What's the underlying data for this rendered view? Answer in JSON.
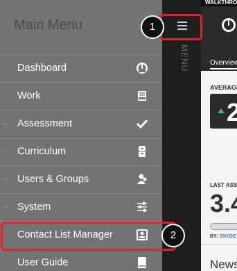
{
  "menu": {
    "title": "Main Menu",
    "items": [
      {
        "label": "Dashboard",
        "icon": "speedometer-icon",
        "has_arrow": false
      },
      {
        "label": "Work",
        "icon": "inbox-tray-icon",
        "has_arrow": true
      },
      {
        "label": "Assessment",
        "icon": "checkmark-icon",
        "has_arrow": true
      },
      {
        "label": "Curriculum",
        "icon": "file-cabinet-icon",
        "has_arrow": true
      },
      {
        "label": "Users & Groups",
        "icon": "users-icon",
        "has_arrow": true
      },
      {
        "label": "System",
        "icon": "sliders-icon",
        "has_arrow": true
      },
      {
        "label": "Contact List Manager",
        "icon": "contact-card-icon",
        "has_arrow": false
      },
      {
        "label": "User Guide",
        "icon": "book-icon",
        "has_arrow": false
      }
    ]
  },
  "menu_tab": {
    "label": "MENU"
  },
  "content": {
    "topbar": "WALKTHRO",
    "tab": "Overview",
    "average_label": "AVERAGE",
    "average_value": "2",
    "last_label": "LAST ASS",
    "last_value": "3.4",
    "by_prefix": "BY:",
    "by_name": "SNYDE",
    "news": "News"
  },
  "callouts": [
    {
      "number": "1",
      "target": "menu-toggle"
    },
    {
      "number": "2",
      "target": "Contact List Manager"
    }
  ],
  "colors": {
    "menu_bg": "#737373",
    "tab_bg": "#1f1f1f",
    "callout_red": "#e0242b",
    "trend_green": "#2ecc40"
  }
}
